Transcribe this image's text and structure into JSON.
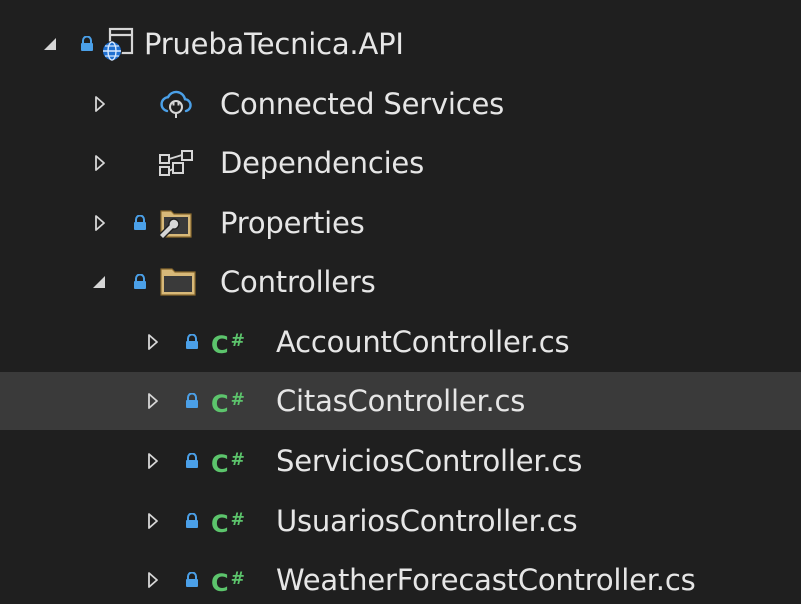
{
  "colors": {
    "background": "#1f1f1f",
    "selected_row": "#3a3a3a",
    "text": "#e6e6e6",
    "lock": "#4ba0e8",
    "csharp": "#5cc46c",
    "folder": "#d8b979"
  },
  "tree": {
    "project": {
      "label": "PruebaTecnica.API",
      "icon": "web-project-icon",
      "expanded": true
    },
    "items": [
      {
        "label": "Connected Services",
        "icon": "cloud-plug-icon",
        "expanded": false
      },
      {
        "label": "Dependencies",
        "icon": "dependencies-icon",
        "expanded": false
      },
      {
        "label": "Properties",
        "icon": "properties-folder-icon",
        "expanded": false
      },
      {
        "label": "Controllers",
        "icon": "folder-icon",
        "expanded": true
      }
    ],
    "controllers": [
      {
        "label": "AccountController.cs",
        "badge": "C#",
        "selected": false
      },
      {
        "label": "CitasController.cs",
        "badge": "C#",
        "selected": true
      },
      {
        "label": "ServiciosController.cs",
        "badge": "C#",
        "selected": false
      },
      {
        "label": "UsuariosController.cs",
        "badge": "C#",
        "selected": false
      },
      {
        "label": "WeatherForecastController.cs",
        "badge": "C#",
        "selected": false
      }
    ]
  }
}
